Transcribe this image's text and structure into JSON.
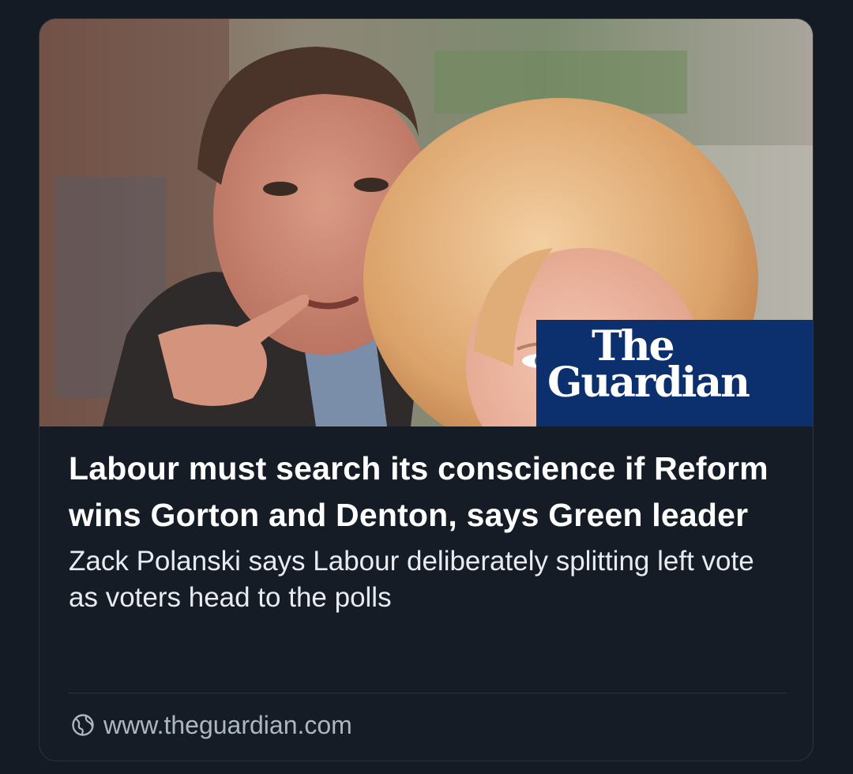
{
  "link_card": {
    "image_alt": "Photo of a man pointing beside a woman with blonde hair",
    "publisher_logo": {
      "line1": "The",
      "line2": "Guardian",
      "background_color": "#0c2f6e"
    },
    "headline": "Labour must search its conscience if Reform wins Gorton and Denton, says Green leader",
    "description": "Zack Polanski says Labour deliberately splitting left vote as voters head to the polls",
    "source": {
      "icon": "globe-icon",
      "domain": "www.theguardian.com"
    }
  }
}
